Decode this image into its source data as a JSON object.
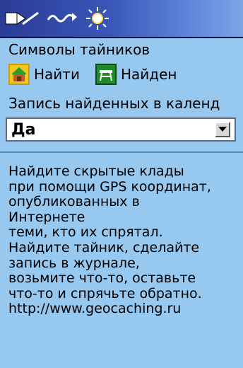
{
  "header": {
    "tabs": [
      {
        "icon": "waypoint-icon"
      },
      {
        "icon": "route-icon"
      },
      {
        "icon": "sun-icon"
      }
    ]
  },
  "colors": {
    "background": "#96c8f0",
    "header_dark": "#2a3c96",
    "header_light": "#7aa6e6"
  },
  "symbols": {
    "label": "Символы тайников",
    "find": {
      "label": "Найти",
      "icon": "geocache-icon"
    },
    "found": {
      "label": "Найден",
      "icon": "geocache-found-icon"
    }
  },
  "calendar": {
    "label": "Запись найденных в календ",
    "value": "Да"
  },
  "description": "Найдите скрытые клады\nпри помощи GPS координат,\nопубликованных в\nИнтернете\nтеми, кто их спрятал.\nНайдите тайник, сделайте\nзапись в журнале,\nвозьмите что-то, оставьте\nчто-то и спрячьте обратно.\nhttp://www.geocaching.ru"
}
